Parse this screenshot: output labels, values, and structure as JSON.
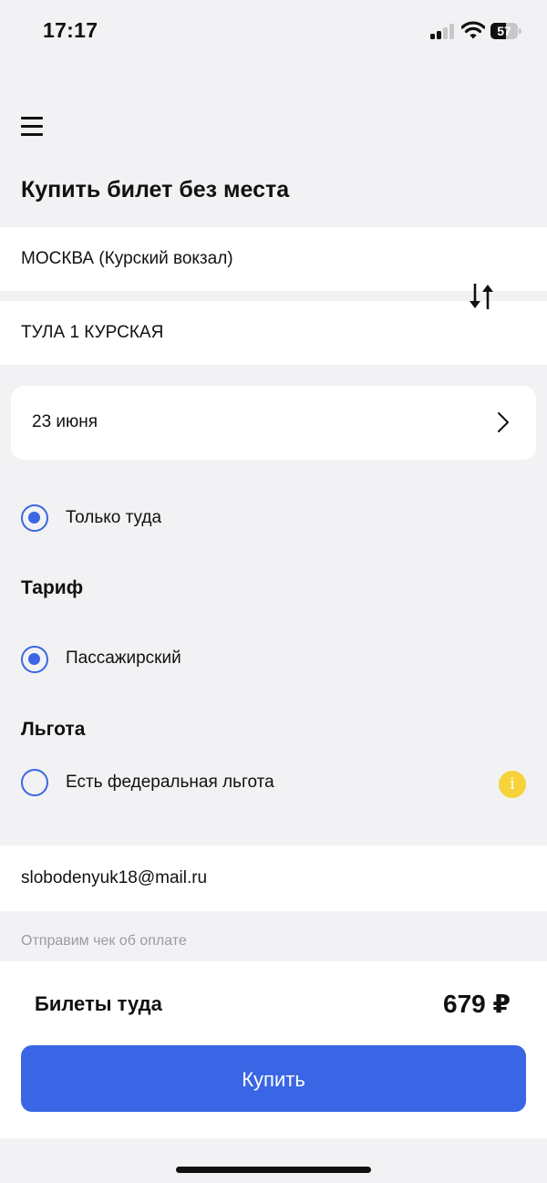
{
  "status_bar": {
    "time": "17:17",
    "battery_level": "57",
    "signal_bars_active": 2,
    "signal_bars_total": 4
  },
  "header": {
    "menu_icon": "hamburger-menu-icon",
    "title": "Купить билет без места"
  },
  "route": {
    "from": "МОСКВА (Курский вокзал)",
    "to": "ТУЛА 1 КУРСКАЯ",
    "swap_icon": "swap-arrows-icon"
  },
  "date": {
    "value": "23 июня",
    "chevron_icon": "chevron-right-icon"
  },
  "trip_type": {
    "label": "Только туда",
    "selected": true
  },
  "tariff": {
    "title": "Тариф",
    "option_label": "Пассажирский",
    "selected": true
  },
  "benefit": {
    "title": "Льгота",
    "option_label": "Есть федеральная льгота",
    "selected": false,
    "info_icon": "info-icon",
    "info_symbol": "i"
  },
  "email": {
    "value": "slobodenyuk18@mail.ru",
    "hint": "Отправим чек об оплате"
  },
  "summary": {
    "label": "Билеты туда",
    "price": "679 ₽",
    "buy_label": "Купить"
  },
  "colors": {
    "accent": "#3a66e5",
    "info": "#f6d33a",
    "background": "#f2f2f4"
  }
}
